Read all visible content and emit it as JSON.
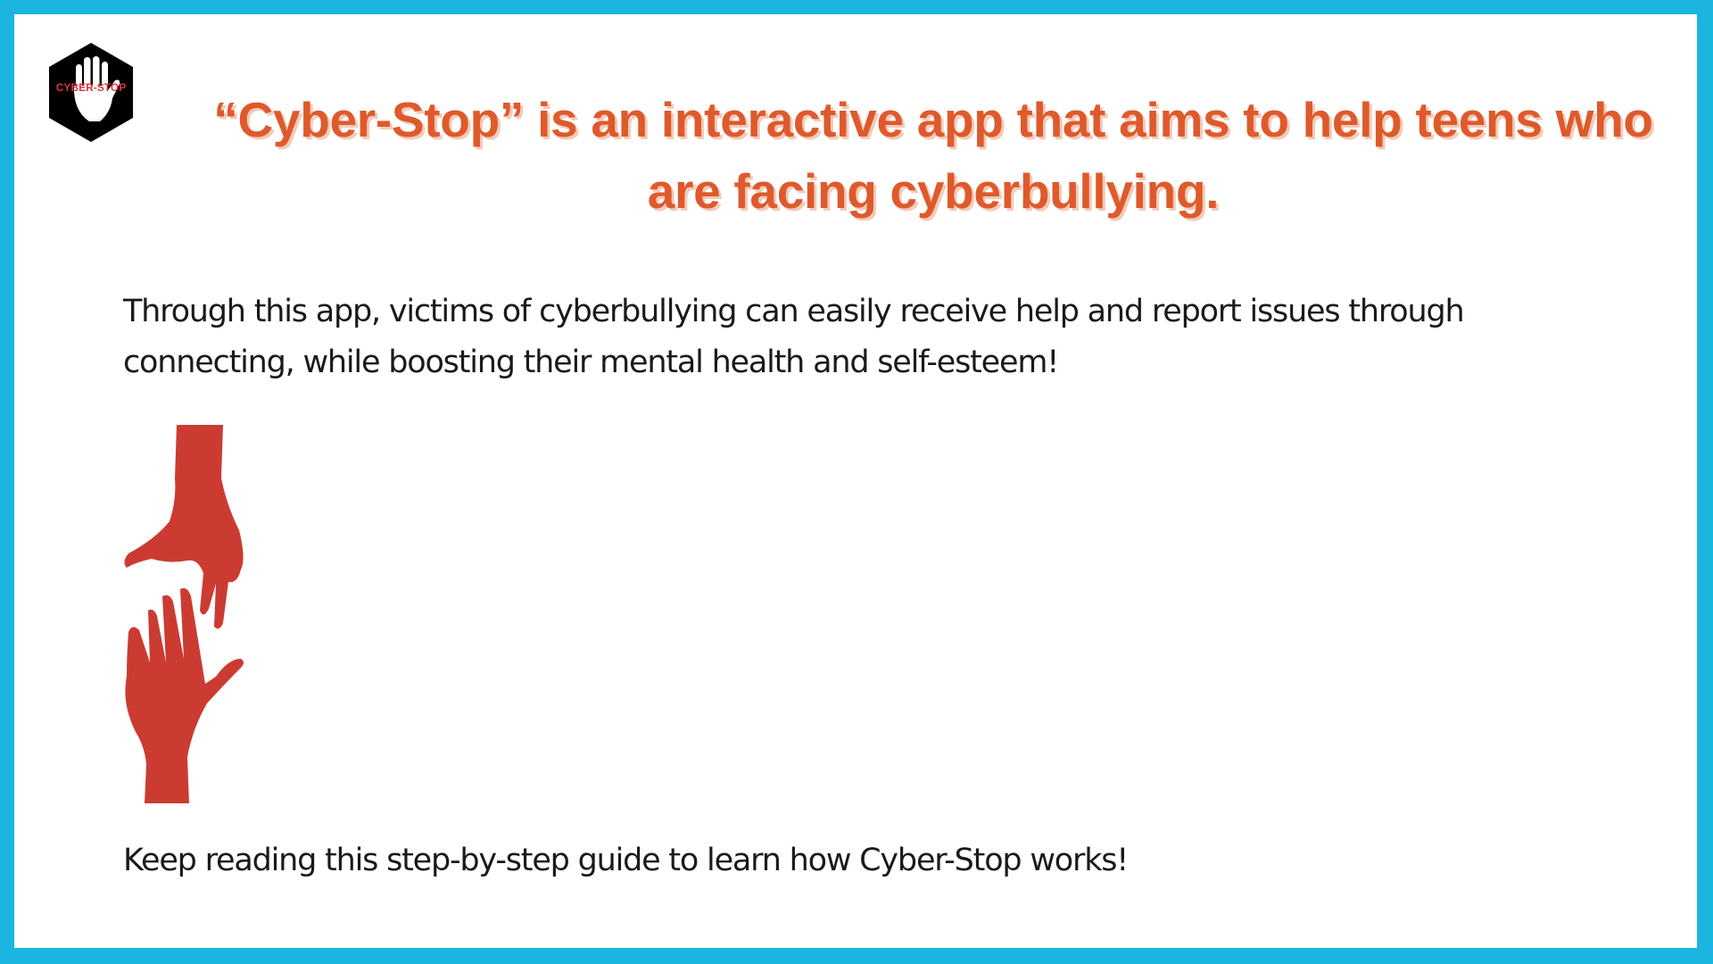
{
  "logo": {
    "text": "CYBER-STOP",
    "icon": "raised-hand-icon",
    "colors": {
      "hex": "#000000",
      "hand": "#ffffff",
      "text": "#d9363e"
    }
  },
  "headline": "“Cyber-Stop” is an interactive app that aims to help teens who are facing cyberbullying.",
  "intro": "Through this app, victims of cyberbullying can easily receive help and report issues through connecting, while boosting their mental health and self-esteem!",
  "illustration": {
    "icon": "reaching-hands-icon",
    "color": "#cc3b32"
  },
  "outro": "Keep reading this step-by-step guide to learn how Cyber-Stop works!",
  "colors": {
    "border": "#1cb5e0",
    "headline": "#de5a2c",
    "body": "#1a1a1a"
  }
}
